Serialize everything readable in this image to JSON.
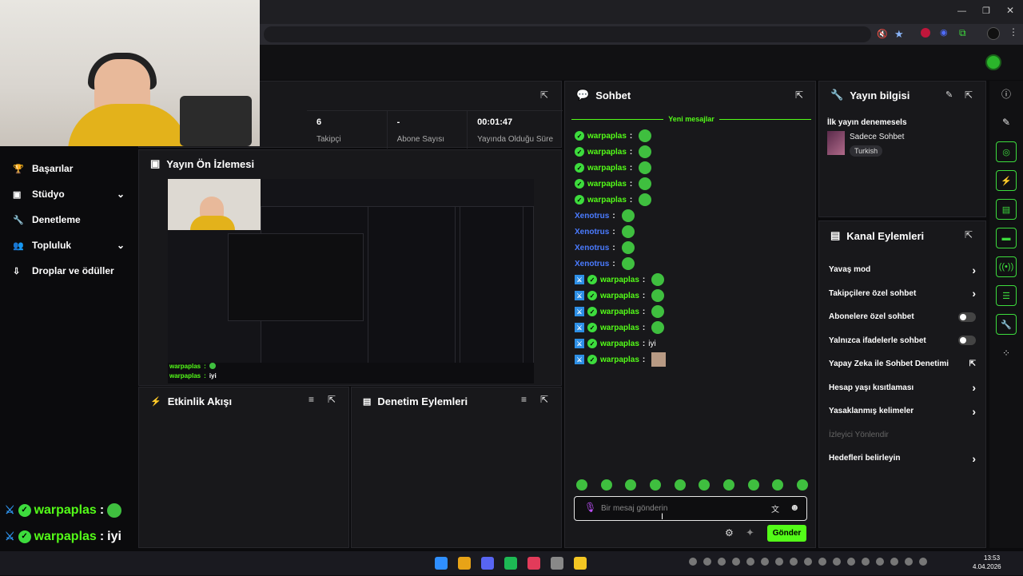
{
  "tab_title": "",
  "dashboard": {
    "stats": [
      {
        "value": "6",
        "label": "Takipçi"
      },
      {
        "value": "-",
        "label": "Abone Sayısı"
      },
      {
        "value": "00:01:47",
        "label": "Yayında Olduğu Süre"
      }
    ]
  },
  "sidebar": {
    "items": [
      {
        "label": "Başarılar",
        "icon": "trophy-icon",
        "chev": ""
      },
      {
        "label": "Stüdyo",
        "icon": "studio-icon",
        "chev": "⌄"
      },
      {
        "label": "Denetleme",
        "icon": "wrench-icon",
        "chev": ""
      },
      {
        "label": "Topluluk",
        "icon": "community-icon",
        "chev": "⌄"
      },
      {
        "label": "Droplar ve ödüller",
        "icon": "drops-icon",
        "chev": ""
      }
    ]
  },
  "preview": {
    "title": "Yayın Ön İzlemesi",
    "overlay_lines": [
      {
        "user": "warpaplas",
        "text": ""
      },
      {
        "user": "warpaplas",
        "text": "iyi"
      }
    ]
  },
  "activity": {
    "title": "Etkinlik Akışı"
  },
  "modlog": {
    "title": "Denetim Eylemleri"
  },
  "chat": {
    "title": "Sohbet",
    "new_messages": "Yeni mesajlar",
    "messages": [
      {
        "user": "warpaplas",
        "text": "",
        "color": "#53fc18",
        "mod": false
      },
      {
        "user": "warpaplas",
        "text": "",
        "color": "#53fc18",
        "mod": false
      },
      {
        "user": "warpaplas",
        "text": "",
        "color": "#53fc18",
        "mod": false
      },
      {
        "user": "warpaplas",
        "text": "",
        "color": "#53fc18",
        "mod": false
      },
      {
        "user": "warpaplas",
        "text": "",
        "color": "#53fc18",
        "mod": false
      },
      {
        "user": "Xenotrus",
        "text": "",
        "color": "#4a7bff",
        "mod": false
      },
      {
        "user": "Xenotrus",
        "text": "",
        "color": "#4a7bff",
        "mod": false
      },
      {
        "user": "Xenotrus",
        "text": "",
        "color": "#4a7bff",
        "mod": false
      },
      {
        "user": "Xenotrus",
        "text": "",
        "color": "#4a7bff",
        "mod": false
      },
      {
        "user": "warpaplas",
        "text": "",
        "color": "#53fc18",
        "mod": true
      },
      {
        "user": "warpaplas",
        "text": "",
        "color": "#53fc18",
        "mod": true
      },
      {
        "user": "warpaplas",
        "text": "",
        "color": "#53fc18",
        "mod": true
      },
      {
        "user": "warpaplas",
        "text": "",
        "color": "#53fc18",
        "mod": true
      },
      {
        "user": "warpaplas",
        "text": "iyi",
        "color": "#53fc18",
        "mod": true
      },
      {
        "user": "warpaplas",
        "text": "",
        "color": "#53fc18",
        "mod": true
      }
    ],
    "input_placeholder": "Bir mesaj gönderin",
    "send_label": "Gönder"
  },
  "stream_info": {
    "title": "Yayın bilgisi",
    "stream_title": "İlk yayın denemesels",
    "category": "Sadece Sohbet",
    "language": "Turkish"
  },
  "channel_actions": {
    "title": "Kanal Eylemleri",
    "items": [
      {
        "label": "Yavaş mod",
        "ctrl": "chevron"
      },
      {
        "label": "Takipçilere özel sohbet",
        "ctrl": "chevron"
      },
      {
        "label": "Abonelere özel sohbet",
        "ctrl": "toggle"
      },
      {
        "label": "Yalnızca ifadelerle sohbet",
        "ctrl": "toggle"
      },
      {
        "label": "Yapay Zeka ile Sohbet Denetimi",
        "ctrl": "external"
      },
      {
        "label": "Hesap yaşı kısıtlaması",
        "ctrl": "chevron"
      },
      {
        "label": "Yasaklanmış kelimeler",
        "ctrl": "chevron"
      },
      {
        "label": "İzleyici Yönlendir",
        "ctrl": "none"
      },
      {
        "label": "Hedefleri belirleyin",
        "ctrl": "chevron"
      }
    ]
  },
  "obs_overlay": [
    {
      "user": "warpaplas",
      "text": ""
    },
    {
      "user": "warpaplas",
      "text": "iyi"
    },
    {
      "user": "warpaplas",
      "text": ""
    }
  ],
  "taskbar": {
    "time": "13:53",
    "date": "4.04.2026"
  },
  "colors": {
    "accent": "#53fc18",
    "panel": "#18181b",
    "bg": "#0b0b0d"
  }
}
